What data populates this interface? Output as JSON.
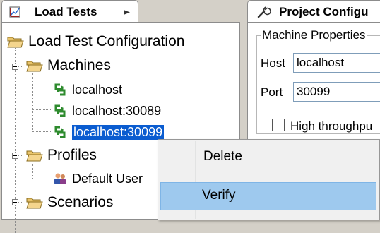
{
  "left_panel": {
    "tab_label": "Load Tests",
    "tree": {
      "root": "Load Test Configuration",
      "machines": {
        "label": "Machines",
        "items": [
          "localhost",
          "localhost:30089",
          "localhost:30099"
        ]
      },
      "profiles": {
        "label": "Profiles",
        "items": [
          "Default User"
        ]
      },
      "scenarios": {
        "label": "Scenarios"
      }
    }
  },
  "right_panel": {
    "tab_label": "Project Configu",
    "group_title": "Machine Properties",
    "host_label": "Host",
    "host_value": "localhost",
    "port_label": "Port",
    "port_value": "30099",
    "checkbox_label": "High throughpu"
  },
  "context_menu": {
    "items": [
      "Delete",
      "Verify"
    ],
    "highlighted": "Verify"
  },
  "colors": {
    "selection": "#0a5cd0",
    "menu_highlight": "#9ec9ee",
    "machine_icon": "#2e8b2e",
    "folder": "#d9a441"
  }
}
